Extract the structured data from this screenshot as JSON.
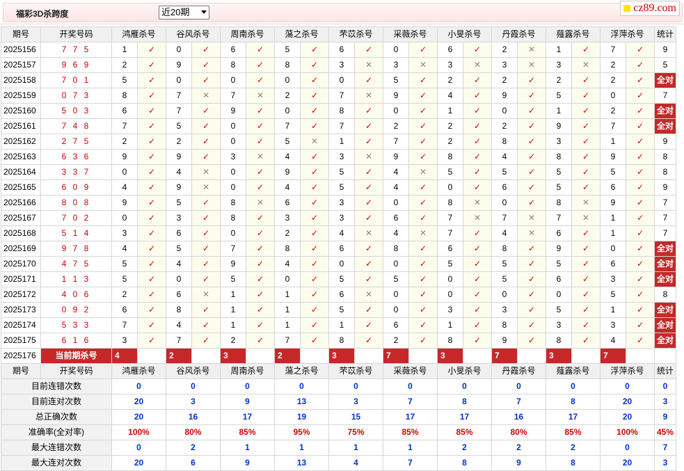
{
  "page_title": "福彩3D杀跨度",
  "period_select": "近20期",
  "logo": "cz89.com",
  "headers": {
    "issue": "期号",
    "draw": "开奖号码",
    "stat": "统计",
    "experts": [
      "鸿雁杀号",
      "谷风杀号",
      "周南杀号",
      "蕩之杀号",
      "芣苡杀号",
      "采薇杀号",
      "小旻杀号",
      "丹霞杀号",
      "薤露杀号",
      "浮萍杀号"
    ]
  },
  "rows": [
    {
      "issue": "2025156",
      "draw": "7 7 5",
      "nums": [
        "1",
        "0",
        "6",
        "5",
        "6",
        "0",
        "6",
        "2",
        "1",
        "7"
      ],
      "res": [
        1,
        1,
        1,
        1,
        1,
        1,
        1,
        0,
        1,
        1
      ],
      "stat": "9"
    },
    {
      "issue": "2025157",
      "draw": "9 6 9",
      "nums": [
        "2",
        "9",
        "8",
        "8",
        "3",
        "3",
        "3",
        "3",
        "3",
        "2"
      ],
      "res": [
        1,
        1,
        1,
        1,
        0,
        0,
        0,
        0,
        0,
        1
      ],
      "stat": "5"
    },
    {
      "issue": "2025158",
      "draw": "7 0 1",
      "nums": [
        "5",
        "0",
        "0",
        "0",
        "0",
        "5",
        "2",
        "2",
        "2",
        "2"
      ],
      "res": [
        1,
        1,
        1,
        1,
        1,
        1,
        1,
        1,
        1,
        1
      ],
      "stat": "全对"
    },
    {
      "issue": "2025159",
      "draw": "0 7 3",
      "nums": [
        "8",
        "7",
        "7",
        "2",
        "7",
        "9",
        "4",
        "9",
        "5",
        "0"
      ],
      "res": [
        1,
        0,
        0,
        1,
        0,
        1,
        1,
        1,
        1,
        1
      ],
      "stat": "7"
    },
    {
      "issue": "2025160",
      "draw": "5 0 3",
      "nums": [
        "6",
        "7",
        "9",
        "0",
        "8",
        "0",
        "1",
        "0",
        "1",
        "2"
      ],
      "res": [
        1,
        1,
        1,
        1,
        1,
        1,
        1,
        1,
        1,
        1
      ],
      "stat": "全对"
    },
    {
      "issue": "2025161",
      "draw": "7 4 8",
      "nums": [
        "7",
        "5",
        "0",
        "7",
        "7",
        "2",
        "2",
        "2",
        "9",
        "7"
      ],
      "res": [
        1,
        1,
        1,
        1,
        1,
        1,
        1,
        1,
        1,
        1
      ],
      "stat": "全对"
    },
    {
      "issue": "2025162",
      "draw": "2 7 5",
      "nums": [
        "2",
        "2",
        "0",
        "5",
        "1",
        "7",
        "2",
        "8",
        "3",
        "1"
      ],
      "res": [
        1,
        1,
        1,
        0,
        1,
        1,
        1,
        1,
        1,
        1
      ],
      "stat": "9"
    },
    {
      "issue": "2025163",
      "draw": "6 3 6",
      "nums": [
        "9",
        "9",
        "3",
        "4",
        "3",
        "9",
        "8",
        "4",
        "8",
        "9"
      ],
      "res": [
        1,
        1,
        0,
        1,
        0,
        1,
        1,
        1,
        1,
        1
      ],
      "stat": "8"
    },
    {
      "issue": "2025164",
      "draw": "3 3 7",
      "nums": [
        "0",
        "4",
        "0",
        "9",
        "5",
        "4",
        "5",
        "5",
        "5",
        "5"
      ],
      "res": [
        1,
        0,
        1,
        1,
        1,
        0,
        1,
        1,
        1,
        1
      ],
      "stat": "8"
    },
    {
      "issue": "2025165",
      "draw": "6 0 9",
      "nums": [
        "4",
        "9",
        "0",
        "4",
        "5",
        "4",
        "0",
        "6",
        "5",
        "6"
      ],
      "res": [
        1,
        0,
        1,
        1,
        1,
        1,
        1,
        1,
        1,
        1
      ],
      "stat": "9"
    },
    {
      "issue": "2025166",
      "draw": "8 0 8",
      "nums": [
        "9",
        "5",
        "8",
        "6",
        "3",
        "0",
        "8",
        "0",
        "8",
        "9"
      ],
      "res": [
        1,
        1,
        0,
        1,
        1,
        1,
        0,
        1,
        0,
        1
      ],
      "stat": "7"
    },
    {
      "issue": "2025167",
      "draw": "7 0 2",
      "nums": [
        "0",
        "3",
        "8",
        "3",
        "3",
        "6",
        "7",
        "7",
        "7",
        "1"
      ],
      "res": [
        1,
        1,
        1,
        1,
        1,
        1,
        0,
        0,
        0,
        1
      ],
      "stat": "7"
    },
    {
      "issue": "2025168",
      "draw": "5 1 4",
      "nums": [
        "3",
        "6",
        "0",
        "2",
        "4",
        "4",
        "7",
        "4",
        "6",
        "1"
      ],
      "res": [
        1,
        1,
        1,
        1,
        0,
        0,
        1,
        0,
        1,
        1
      ],
      "stat": "7"
    },
    {
      "issue": "2025169",
      "draw": "9 7 8",
      "nums": [
        "4",
        "5",
        "7",
        "8",
        "6",
        "8",
        "6",
        "8",
        "9",
        "0"
      ],
      "res": [
        1,
        1,
        1,
        1,
        1,
        1,
        1,
        1,
        1,
        1
      ],
      "stat": "全对"
    },
    {
      "issue": "2025170",
      "draw": "4 7 5",
      "nums": [
        "5",
        "4",
        "9",
        "4",
        "0",
        "0",
        "5",
        "5",
        "5",
        "6"
      ],
      "res": [
        1,
        1,
        1,
        1,
        1,
        1,
        1,
        1,
        1,
        1
      ],
      "stat": "全对"
    },
    {
      "issue": "2025171",
      "draw": "1 1 3",
      "nums": [
        "5",
        "0",
        "5",
        "0",
        "5",
        "5",
        "0",
        "5",
        "6",
        "3"
      ],
      "res": [
        1,
        1,
        1,
        1,
        1,
        1,
        1,
        1,
        1,
        1
      ],
      "stat": "全对"
    },
    {
      "issue": "2025172",
      "draw": "4 0 6",
      "nums": [
        "2",
        "6",
        "1",
        "1",
        "6",
        "0",
        "0",
        "0",
        "0",
        "5"
      ],
      "res": [
        1,
        0,
        1,
        1,
        0,
        1,
        1,
        1,
        1,
        1
      ],
      "stat": "8"
    },
    {
      "issue": "2025173",
      "draw": "0 9 2",
      "nums": [
        "6",
        "8",
        "1",
        "1",
        "5",
        "0",
        "3",
        "3",
        "5",
        "1"
      ],
      "res": [
        1,
        1,
        1,
        1,
        1,
        1,
        1,
        1,
        1,
        1
      ],
      "stat": "全对"
    },
    {
      "issue": "2025174",
      "draw": "5 3 3",
      "nums": [
        "7",
        "4",
        "1",
        "1",
        "1",
        "6",
        "1",
        "8",
        "3",
        "3"
      ],
      "res": [
        1,
        1,
        1,
        1,
        1,
        1,
        1,
        1,
        1,
        1
      ],
      "stat": "全对"
    },
    {
      "issue": "2025175",
      "draw": "6 1 6",
      "nums": [
        "3",
        "7",
        "2",
        "7",
        "8",
        "2",
        "8",
        "9",
        "8",
        "4"
      ],
      "res": [
        1,
        1,
        1,
        1,
        1,
        1,
        1,
        1,
        1,
        1
      ],
      "stat": "全对"
    }
  ],
  "current": {
    "issue": "2025176",
    "label": "当前期杀号",
    "nums": [
      "4",
      "2",
      "3",
      "2",
      "3",
      "7",
      "3",
      "7",
      "3",
      "7"
    ]
  },
  "summary_rows": [
    {
      "label": "目前连错次数",
      "vals": [
        "0",
        "0",
        "0",
        "0",
        "0",
        "0",
        "0",
        "0",
        "0",
        "0"
      ],
      "stat": "0",
      "cls": "sv"
    },
    {
      "label": "目前连对次数",
      "vals": [
        "20",
        "3",
        "9",
        "13",
        "3",
        "7",
        "8",
        "7",
        "8",
        "20"
      ],
      "stat": "3",
      "cls": "sv"
    },
    {
      "label": "总正确次数",
      "vals": [
        "20",
        "16",
        "17",
        "19",
        "15",
        "17",
        "17",
        "16",
        "17",
        "20"
      ],
      "stat": "9",
      "cls": "sv"
    },
    {
      "label": "准确率(全对率)",
      "vals": [
        "100%",
        "80%",
        "85%",
        "95%",
        "75%",
        "85%",
        "85%",
        "80%",
        "85%",
        "100%"
      ],
      "stat": "45%",
      "cls": "sr"
    },
    {
      "label": "最大连错次数",
      "vals": [
        "0",
        "2",
        "1",
        "1",
        "1",
        "1",
        "2",
        "2",
        "2",
        "0"
      ],
      "stat": "7",
      "cls": "sv"
    },
    {
      "label": "最大连对次数",
      "vals": [
        "20",
        "6",
        "9",
        "13",
        "4",
        "7",
        "8",
        "9",
        "8",
        "20"
      ],
      "stat": "3",
      "cls": "sv"
    }
  ],
  "marks": {
    "ok": "✓",
    "bad": "✕"
  },
  "colors": {
    "accent_red": "#c62828",
    "check_red": "#d40000",
    "stat_blue": "#0033cc"
  }
}
